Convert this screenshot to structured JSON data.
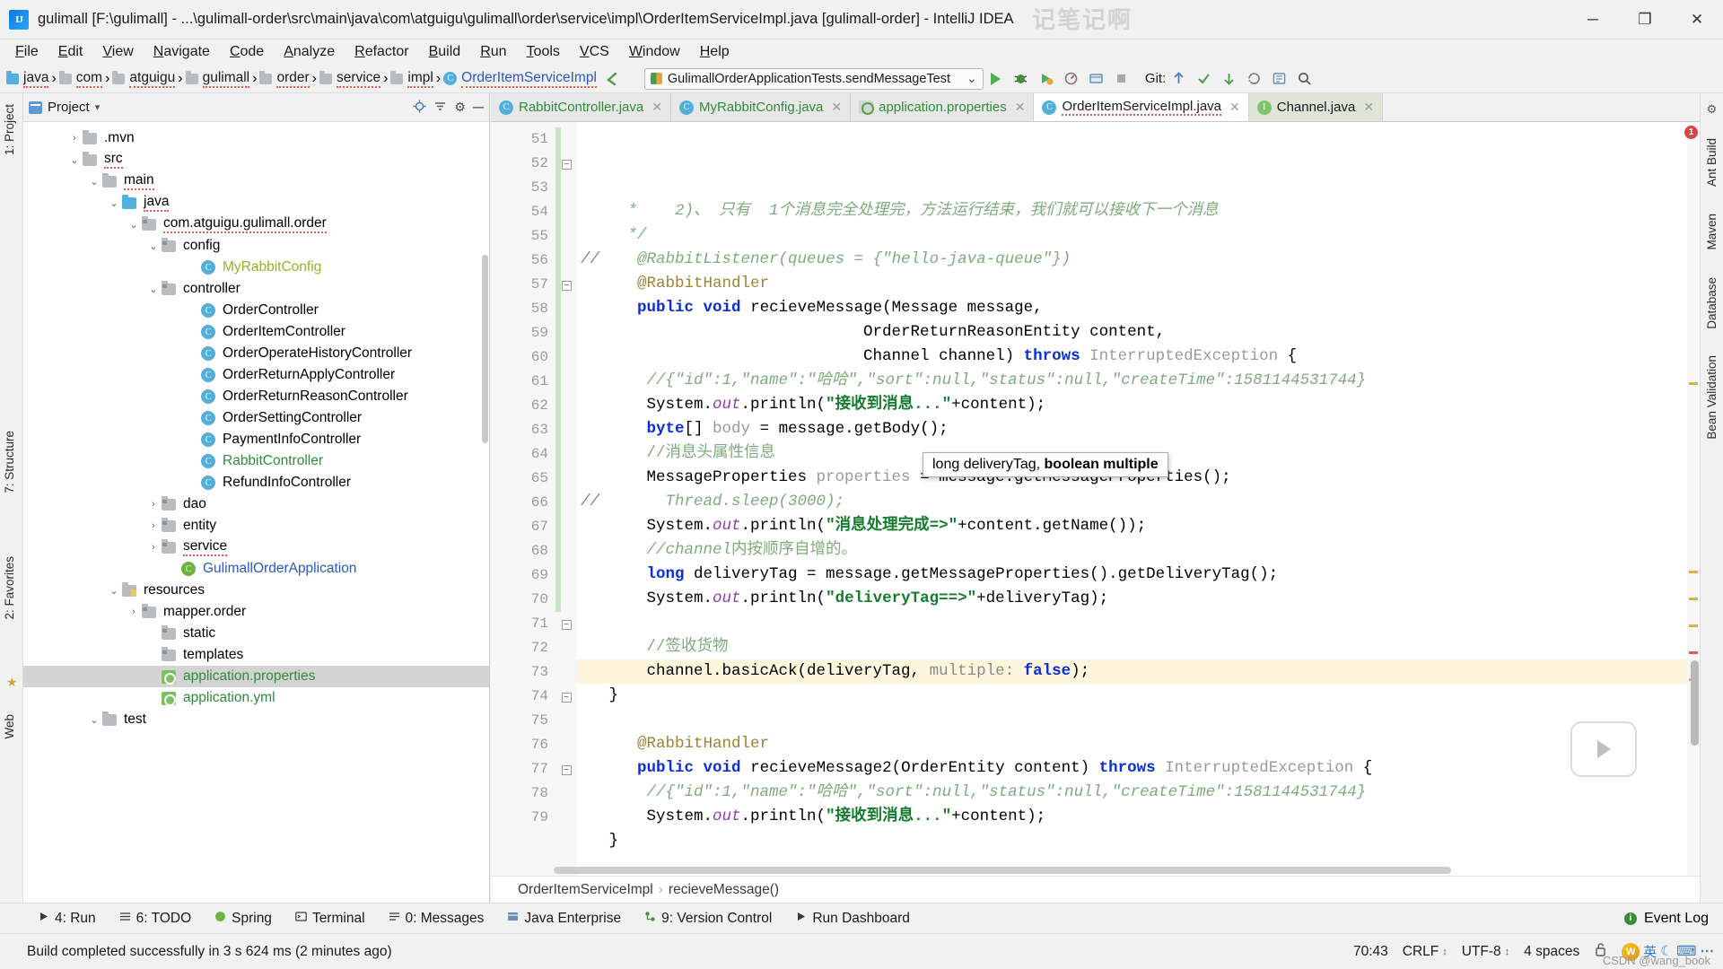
{
  "window": {
    "title": "gulimall [F:\\gulimall] - ...\\gulimall-order\\src\\main\\java\\com\\atguigu\\gulimall\\order\\service\\impl\\OrderItemServiceImpl.java [gulimall-order] - IntelliJ IDEA",
    "logo_text": "IJ",
    "watermark": "记笔记啊",
    "minimize": "─",
    "maximize": "❐",
    "close": "✕"
  },
  "menu": [
    "File",
    "Edit",
    "View",
    "Navigate",
    "Code",
    "Analyze",
    "Refactor",
    "Build",
    "Run",
    "Tools",
    "VCS",
    "Window",
    "Help"
  ],
  "breadcrumb": [
    {
      "label": "java",
      "icon": "folder-blue-icon"
    },
    {
      "label": "com",
      "icon": "folder-gray-icon"
    },
    {
      "label": "atguigu",
      "icon": "folder-gray-icon"
    },
    {
      "label": "gulimall",
      "icon": "folder-gray-icon"
    },
    {
      "label": "order",
      "icon": "folder-gray-icon"
    },
    {
      "label": "service",
      "icon": "folder-gray-icon"
    },
    {
      "label": "impl",
      "icon": "folder-gray-icon"
    },
    {
      "label": "OrderItemServiceImpl",
      "icon": "class-icon"
    }
  ],
  "toolbar": {
    "run_configuration": "GulimallOrderApplicationTests.sendMessageTest",
    "dropdown_caret": "⌄",
    "run_label": "run-button",
    "debug_label": "debug-button",
    "git_label": "Git:",
    "icons": [
      "back-arrow-icon",
      "run-icon",
      "debug-icon",
      "run-coverage-icon",
      "profiler-icon",
      "build-icon",
      "stop-icon",
      "git-update-icon",
      "git-commit-icon",
      "git-push-icon",
      "git-history-icon",
      "search-everywhere-icon",
      "settings-icon"
    ]
  },
  "left_strip": [
    {
      "label": "1: Project"
    },
    {
      "label": "7: Structure"
    },
    {
      "label": "2: Favorites"
    },
    {
      "label": "Web"
    }
  ],
  "right_strip": [
    {
      "label": "Ant Build"
    },
    {
      "label": "Maven"
    },
    {
      "label": "Database"
    },
    {
      "label": "Bean Validation"
    }
  ],
  "project_panel": {
    "title": "Project",
    "caret": "▾",
    "icons": [
      "locate-icon",
      "collapse-all-icon",
      "settings-icon",
      "hide-icon"
    ],
    "tree": [
      {
        "indent": 2,
        "arrow": "›",
        "icon": "folder-gray",
        "label": ".mvn",
        "color": "plain"
      },
      {
        "indent": 2,
        "arrow": "⌄",
        "icon": "folder-src",
        "label": "src",
        "color": "plain",
        "squig": true
      },
      {
        "indent": 3,
        "arrow": "⌄",
        "icon": "folder-gray",
        "label": "main",
        "color": "plain",
        "squig": true
      },
      {
        "indent": 4,
        "arrow": "⌄",
        "icon": "folder-blue",
        "label": "java",
        "color": "plain",
        "squig": true
      },
      {
        "indent": 5,
        "arrow": "⌄",
        "icon": "pkg",
        "label": "com.atguigu.gulimall.order",
        "color": "plain",
        "squig": true
      },
      {
        "indent": 6,
        "arrow": "⌄",
        "icon": "pkg",
        "label": "config",
        "color": "plain"
      },
      {
        "indent": 8,
        "arrow": "",
        "icon": "class",
        "label": "MyRabbitConfig",
        "color": "lime"
      },
      {
        "indent": 6,
        "arrow": "⌄",
        "icon": "pkg",
        "label": "controller",
        "color": "plain"
      },
      {
        "indent": 8,
        "arrow": "",
        "icon": "class",
        "label": "OrderController",
        "color": "plain"
      },
      {
        "indent": 8,
        "arrow": "",
        "icon": "class",
        "label": "OrderItemController",
        "color": "plain"
      },
      {
        "indent": 8,
        "arrow": "",
        "icon": "class",
        "label": "OrderOperateHistoryController",
        "color": "plain"
      },
      {
        "indent": 8,
        "arrow": "",
        "icon": "class",
        "label": "OrderReturnApplyController",
        "color": "plain"
      },
      {
        "indent": 8,
        "arrow": "",
        "icon": "class",
        "label": "OrderReturnReasonController",
        "color": "plain"
      },
      {
        "indent": 8,
        "arrow": "",
        "icon": "class",
        "label": "OrderSettingController",
        "color": "plain"
      },
      {
        "indent": 8,
        "arrow": "",
        "icon": "class",
        "label": "PaymentInfoController",
        "color": "plain"
      },
      {
        "indent": 8,
        "arrow": "",
        "icon": "class",
        "label": "RabbitController",
        "color": "green"
      },
      {
        "indent": 8,
        "arrow": "",
        "icon": "class",
        "label": "RefundInfoController",
        "color": "plain"
      },
      {
        "indent": 6,
        "arrow": "›",
        "icon": "pkg",
        "label": "dao",
        "color": "plain"
      },
      {
        "indent": 6,
        "arrow": "›",
        "icon": "pkg",
        "label": "entity",
        "color": "plain"
      },
      {
        "indent": 6,
        "arrow": "›",
        "icon": "pkg",
        "label": "service",
        "color": "plain",
        "squig": true
      },
      {
        "indent": 7,
        "arrow": "",
        "icon": "spring",
        "label": "GulimallOrderApplication",
        "color": "blue"
      },
      {
        "indent": 4,
        "arrow": "⌄",
        "icon": "folder-res",
        "label": "resources",
        "color": "plain"
      },
      {
        "indent": 5,
        "arrow": "›",
        "icon": "pkg",
        "label": "mapper.order",
        "color": "plain"
      },
      {
        "indent": 6,
        "arrow": "",
        "icon": "pkg",
        "label": "static",
        "color": "plain"
      },
      {
        "indent": 6,
        "arrow": "",
        "icon": "pkg",
        "label": "templates",
        "color": "plain"
      },
      {
        "indent": 6,
        "arrow": "",
        "icon": "properties",
        "label": "application.properties",
        "color": "green",
        "selected": true
      },
      {
        "indent": 6,
        "arrow": "",
        "icon": "properties",
        "label": "application.yml",
        "color": "green"
      },
      {
        "indent": 3,
        "arrow": "⌄",
        "icon": "folder-gray",
        "label": "test",
        "color": "plain"
      }
    ]
  },
  "editor": {
    "tabs": [
      {
        "label": "RabbitController.java",
        "icon": "class-icon",
        "state": "inactive",
        "color": "green",
        "close": "✕"
      },
      {
        "label": "MyRabbitConfig.java",
        "icon": "class-icon",
        "state": "inactive",
        "color": "green",
        "close": "✕"
      },
      {
        "label": "application.properties",
        "icon": "properties-icon",
        "state": "inactive",
        "color": "green",
        "close": "✕"
      },
      {
        "label": "OrderItemServiceImpl.java",
        "icon": "class-icon",
        "state": "active",
        "color": "error",
        "close": "✕"
      },
      {
        "label": "Channel.java",
        "icon": "interface-icon",
        "state": "pinned",
        "color": "plain",
        "close": "✕"
      }
    ],
    "first_line_no": 51,
    "lines": [
      {
        "n": 51,
        "html": "<span class='cmt'>     *    2)、 只有  1个消息完全处理完，方法运行结束，我们就可以接收下一个消息</span>",
        "clipped": true
      },
      {
        "n": 52,
        "html": "<span class='cmt'>     */</span>",
        "fold": "minus"
      },
      {
        "n": 53,
        "html": "<span class='slashcmt'>//</span>    <span class='cmt'>@RabbitListener(queues = {\"hello-java-queue\"})</span>"
      },
      {
        "n": 54,
        "html": "      <span class='ann'>@RabbitHandler</span>"
      },
      {
        "n": 55,
        "html": "      <span class='kw'>public</span> <span class='kw'>void</span> recieveMessage(Message message,",
        "mark": "@"
      },
      {
        "n": 56,
        "html": "                              OrderReturnReasonEntity content,"
      },
      {
        "n": 57,
        "html": "                              Channel channel) <span class='kw'>throws</span> <span class='dim'>InterruptedException</span> {",
        "fold": "minus"
      },
      {
        "n": 58,
        "html": "       <span class='cmt'>//{\"id\":1,\"name\":\"哈哈\",\"sort\":null,\"status\":null,\"createTime\":1581144531744}</span>"
      },
      {
        "n": 59,
        "html": "       System.<span class='fld'>out</span>.println(<span class='str'>\"接收到消息...\"</span>+content);"
      },
      {
        "n": 60,
        "html": "       <span class='kw'>byte</span>[] <span class='dim'>body</span> = message.getBody();"
      },
      {
        "n": 61,
        "html": "       <span class='cmt2'>//消息头属性信息</span>"
      },
      {
        "n": 62,
        "html": "       MessageProperties <span class='dim'>properties</span> = message.getMessageProperties();"
      },
      {
        "n": 63,
        "html": "<span class='slashcmt'>//</span>       <span class='cmt'>Thread.sleep(3000);</span>"
      },
      {
        "n": 64,
        "html": "       System.<span class='fld'>out</span>.println(<span class='str'>\"消息处理完成=&gt;\"</span>+content.getName());"
      },
      {
        "n": 65,
        "html": "       <span class='cmt'>//channel</span><span class='cmt2'>内按顺序自增的。</span>"
      },
      {
        "n": 66,
        "html": "       <span class='kw'>long</span> deliveryTag = message.getMessageProperties().getDeliveryTag();"
      },
      {
        "n": 67,
        "html": "       System.<span class='fld'>out</span>.println(<span class='str'>\"deliveryTag==&gt;\"</span>+deliveryTag);"
      },
      {
        "n": 68,
        "html": ""
      },
      {
        "n": 69,
        "html": "       <span class='cmt2'>//签收货物</span>"
      },
      {
        "n": 70,
        "html": "       channel.basicAck(deliveryTag, <span class='hintp'>multiple:</span> <span class='kw'>false</span>);",
        "highlight": true
      },
      {
        "n": 71,
        "html": "   }",
        "fold": "minus"
      },
      {
        "n": 72,
        "html": ""
      },
      {
        "n": 73,
        "html": "      <span class='ann'>@RabbitHandler</span>"
      },
      {
        "n": 74,
        "html": "      <span class='kw'>public</span> <span class='kw'>void</span> recieveMessage2(OrderEntity content) <span class='kw'>throws</span> <span class='dim'>InterruptedException</span> {",
        "fold": "minus"
      },
      {
        "n": 75,
        "html": "       <span class='cmt'>//{\"id\":1,\"name\":\"哈哈\",\"sort\":null,\"status\":null,\"createTime\":1581144531744}</span>"
      },
      {
        "n": 76,
        "html": "       System.<span class='fld'>out</span>.println(<span class='str'>\"接收到消息...\"</span>+content);"
      },
      {
        "n": 77,
        "html": "   }",
        "fold": "minus"
      },
      {
        "n": 78,
        "html": ""
      },
      {
        "n": 79,
        "html": "  }"
      }
    ],
    "tooltip": {
      "prefix": "long deliveryTag, ",
      "bold": "boolean multiple"
    },
    "error_badge": "1",
    "bottom_breadcrumb": [
      "OrderItemServiceImpl",
      "recieveMessage()"
    ],
    "bottom_sep": "›"
  },
  "tool_windows": [
    {
      "label": "4: Run",
      "icon": "play-icon"
    },
    {
      "label": "6: TODO",
      "icon": "list-icon"
    },
    {
      "label": "Spring",
      "icon": "spring-icon"
    },
    {
      "label": "Terminal",
      "icon": "terminal-icon"
    },
    {
      "label": "0: Messages",
      "icon": "messages-icon"
    },
    {
      "label": "Java Enterprise",
      "icon": "jee-icon"
    },
    {
      "label": "9: Version Control",
      "icon": "vcs-icon"
    },
    {
      "label": "Run Dashboard",
      "icon": "play-icon"
    }
  ],
  "event_log": {
    "label": "Event Log",
    "badge": "i"
  },
  "status": {
    "message": "Build completed successfully in 3 s 624 ms (2 minutes ago)",
    "caret_position": "70:43",
    "line_separator": "CRLF",
    "separator_caret": "↕",
    "encoding": "UTF-8",
    "encoding_caret": "↕",
    "indent": "4 spaces",
    "ime_char": "英",
    "ime_icons": [
      "moon-icon",
      "keyboard-icon",
      "more-icon"
    ],
    "lock_icon": "lock-open-icon",
    "watermark": "CSDN @wang_book"
  }
}
